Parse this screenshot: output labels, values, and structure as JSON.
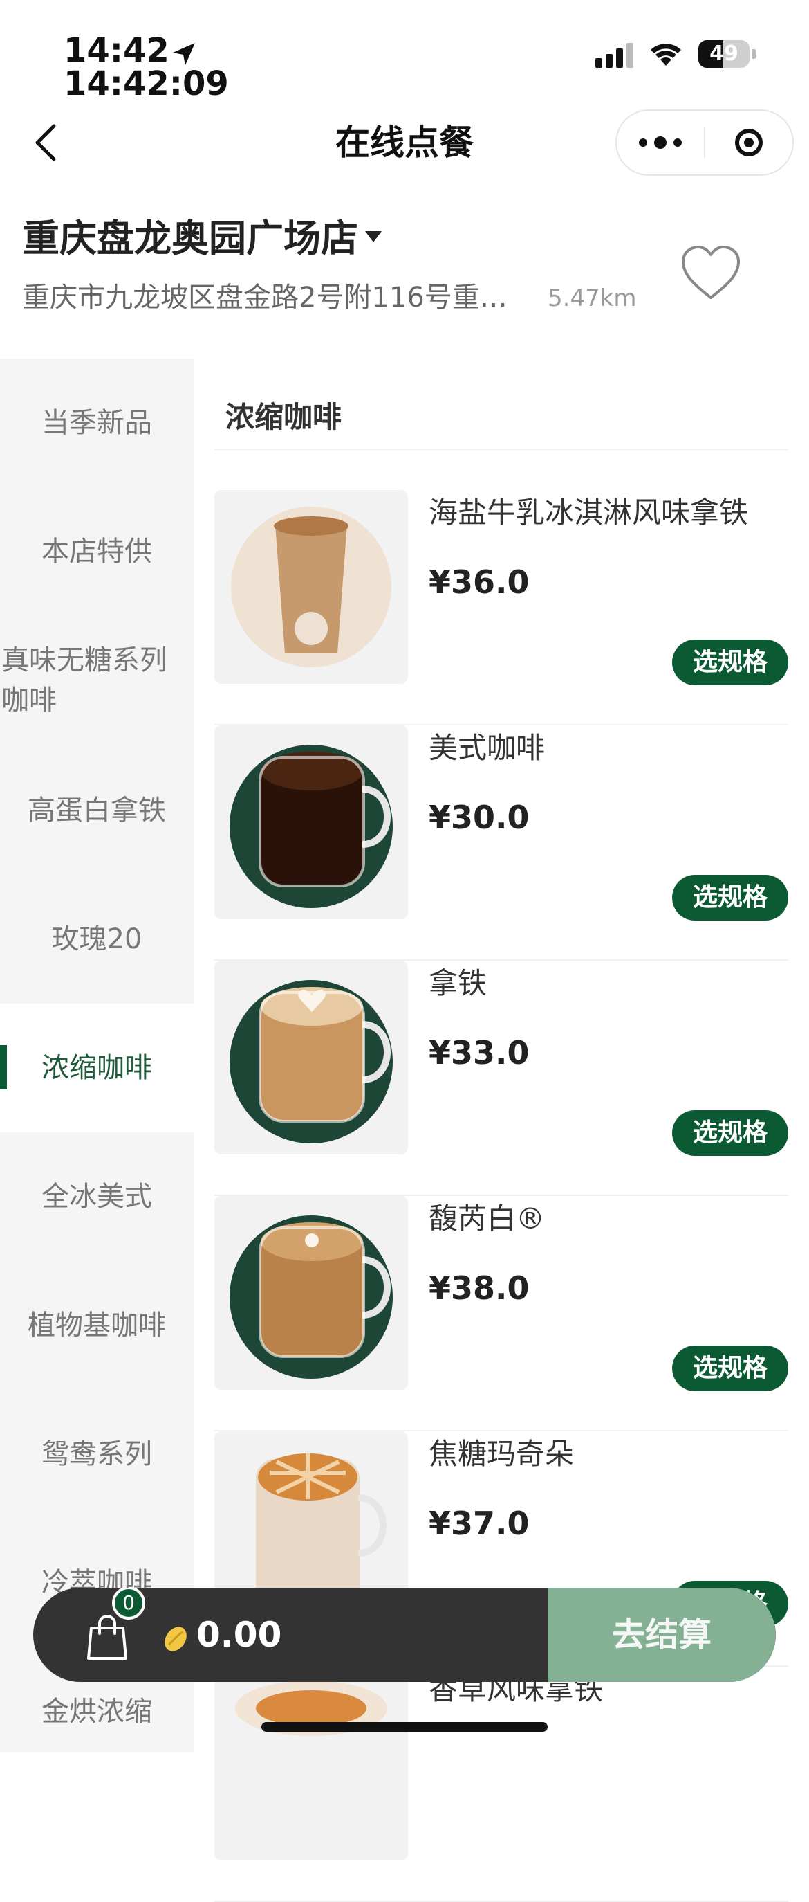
{
  "status_bar": {
    "time": "14:42",
    "time_seconds": "14:42:09",
    "battery": "49",
    "battery_level": 0.49
  },
  "nav": {
    "title": "在线点餐"
  },
  "store": {
    "name": "重庆盘龙奥园广场店",
    "address": "重庆市九龙坡区盘金路2号附116号重…",
    "distance": "5.47km"
  },
  "categories": [
    {
      "label": "当季新品",
      "active": false
    },
    {
      "label": "本店特供",
      "active": false
    },
    {
      "label": "真味无糖系列\n咖啡",
      "active": false
    },
    {
      "label": "高蛋白拿铁",
      "active": false
    },
    {
      "label": "玫瑰20",
      "active": false
    },
    {
      "label": "浓缩咖啡",
      "active": true
    },
    {
      "label": "全冰美式",
      "active": false
    },
    {
      "label": "植物基咖啡",
      "active": false
    },
    {
      "label": "鸳鸯系列",
      "active": false
    },
    {
      "label": "冷萃咖啡",
      "active": false
    },
    {
      "label": "金烘浓缩",
      "active": false
    }
  ],
  "section": {
    "title": "浓缩咖啡"
  },
  "products": [
    {
      "name": "海盐牛乳冰淇淋风味拿铁",
      "price": "¥36.0",
      "button": "选规格"
    },
    {
      "name": "美式咖啡",
      "price": "¥30.0",
      "button": "选规格"
    },
    {
      "name": "拿铁",
      "price": "¥33.0",
      "button": "选规格"
    },
    {
      "name": "馥芮白®",
      "price": "¥38.0",
      "button": "选规格"
    },
    {
      "name": "焦糖玛奇朵",
      "price": "¥37.0",
      "button": "选规格"
    },
    {
      "name": "香草风味拿铁",
      "price": "",
      "button": ""
    }
  ],
  "cart": {
    "count": "0",
    "total": "0.00",
    "checkout_label": "去结算"
  },
  "colors": {
    "brand_green": "#0b5a33",
    "checkout_green": "#84b094",
    "cart_bar": "#333333"
  }
}
